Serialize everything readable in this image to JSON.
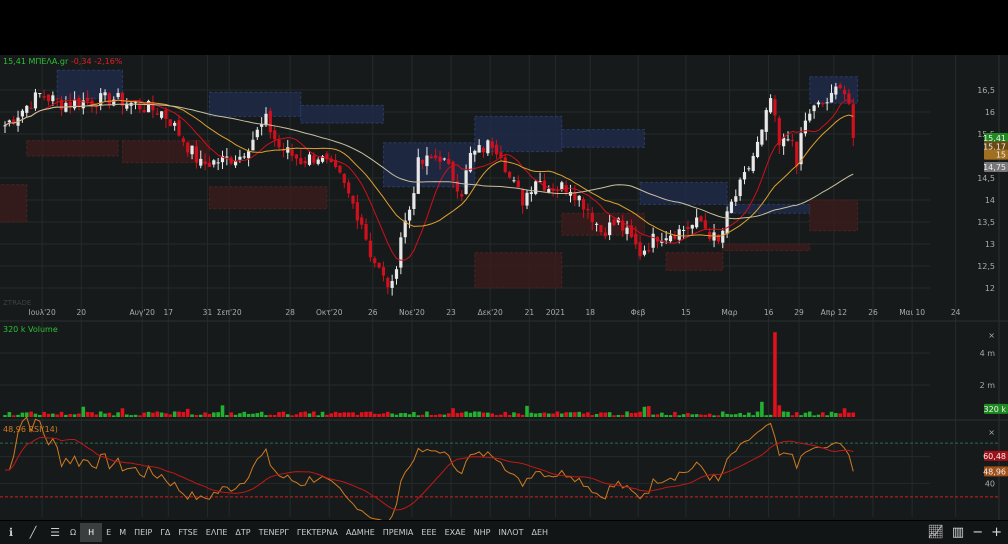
{
  "header": {
    "price": "15,41",
    "symbol": "ΜΠΕΛΑ.gr",
    "change": "-0,34",
    "change_pct": "-2,16%"
  },
  "watermark": "ZTRADE",
  "volume_legend": "320 k Volume",
  "rsi_legend": "48,96 RSI(14)",
  "toolbar": {
    "items": [
      "Ω",
      "Η",
      "Ε",
      "Μ",
      "ΠΕΙΡ",
      "ΓΔ",
      "FTSE",
      "ΕΛΠΕ",
      "ΔΤΡ",
      "ΤΕΝΕΡΓ",
      "ΓΕΚΤΕΡΝΑ",
      "ΑΔΜΗΕ",
      "ΠΡΕΜΙΑ",
      "ΕΕΕ",
      "ΕΧΑΕ",
      "ΝΗΡ",
      "ΙΝΛΟΤ",
      "ΔΕΗ"
    ],
    "active": "Η"
  },
  "colors": {
    "up": "#e8e8e8",
    "down": "#d0101c",
    "ma_short": "#d0101c",
    "ma_mid": "#e0a030",
    "ma_long": "#c8c0a0",
    "vol_up": "#23b030",
    "vol_down": "#e0101c",
    "rsi": "#d07a20",
    "rsi_ma": "#c01818"
  },
  "chart_data": [
    {
      "type": "candlestick",
      "title": "ΜΠΕΛΑ.gr",
      "price_keypoints": [
        [
          0,
          15.7
        ],
        [
          8,
          16.4
        ],
        [
          13,
          16.2
        ],
        [
          25,
          16.3
        ],
        [
          36,
          16.0
        ],
        [
          38,
          15.8
        ],
        [
          45,
          14.8
        ],
        [
          54,
          15.0
        ],
        [
          60,
          15.8
        ],
        [
          63,
          15.2
        ],
        [
          68,
          14.9
        ],
        [
          72,
          15.0
        ],
        [
          77,
          14.5
        ],
        [
          82,
          13.5
        ],
        [
          84,
          12.8
        ],
        [
          87,
          12.2
        ],
        [
          89,
          12.0
        ],
        [
          91,
          13.2
        ],
        [
          93,
          13.8
        ],
        [
          95,
          14.8
        ],
        [
          100,
          15.0
        ],
        [
          105,
          14.2
        ],
        [
          107,
          15.0
        ],
        [
          112,
          15.3
        ],
        [
          114,
          15.1
        ],
        [
          116,
          14.5
        ],
        [
          119,
          14.0
        ],
        [
          122,
          14.5
        ],
        [
          125,
          14.3
        ],
        [
          130,
          14.3
        ],
        [
          134,
          13.8
        ],
        [
          137,
          13.3
        ],
        [
          141,
          13.5
        ],
        [
          146,
          12.8
        ],
        [
          150,
          13.2
        ],
        [
          155,
          13.3
        ],
        [
          160,
          13.5
        ],
        [
          164,
          13.0
        ],
        [
          167,
          13.9
        ],
        [
          170,
          14.5
        ],
        [
          174,
          15.5
        ],
        [
          176,
          16.3
        ],
        [
          178,
          15.2
        ],
        [
          181,
          15.5
        ],
        [
          182,
          14.6
        ],
        [
          183,
          15.5
        ],
        [
          185,
          16.0
        ],
        [
          190,
          16.3
        ],
        [
          192,
          16.7
        ],
        [
          194,
          16.2
        ],
        [
          195,
          15.41
        ]
      ],
      "yaxis": {
        "ticks": [
          "16,5",
          "16",
          "15,5",
          "14,5",
          "14",
          "13,5",
          "13",
          "12,5",
          "12"
        ],
        "tick_values": [
          16.5,
          16,
          15.5,
          14.5,
          14,
          13.5,
          13,
          12.5,
          12
        ],
        "range": [
          11.75,
          17.1
        ]
      },
      "xaxis": {
        "ticks": [
          "Ιουλ'20",
          "20",
          "Αυγ'20",
          "17",
          "31",
          "Σεπ'20",
          "28",
          "Οκτ'20",
          "26",
          "Νοε'20",
          "23",
          "Δεκ'20",
          "21",
          "2021",
          "18",
          "Φεβ",
          "15",
          "Μαρ",
          "16",
          "29",
          "Απρ 12",
          "26",
          "Μαι 10",
          "24"
        ],
        "tick_index": [
          9,
          18,
          32,
          38,
          47,
          52,
          66,
          75,
          85,
          94,
          103,
          112,
          121,
          127,
          135,
          146,
          157,
          167,
          176,
          183,
          191,
          200,
          209,
          219
        ]
      },
      "moving_averages": [
        {
          "name": "MA short",
          "period": 10,
          "last": "15,17"
        },
        {
          "name": "MA mid",
          "period": 20,
          "last": "15"
        },
        {
          "name": "MA long",
          "period": 50,
          "last": "14,75"
        }
      ],
      "last_price": "15,41",
      "zones": [
        {
          "i0": 12,
          "i1": 27,
          "p0": 16.95,
          "p1": 16.3,
          "kind": "supply"
        },
        {
          "i0": 47,
          "i1": 68,
          "p0": 16.45,
          "p1": 15.9,
          "kind": "supply"
        },
        {
          "i0": 68,
          "i1": 87,
          "p0": 16.15,
          "p1": 15.75,
          "kind": "supply"
        },
        {
          "i0": 87,
          "i1": 108,
          "p0": 15.3,
          "p1": 14.3,
          "kind": "supply"
        },
        {
          "i0": 108,
          "i1": 128,
          "p0": 15.9,
          "p1": 15.1,
          "kind": "supply"
        },
        {
          "i0": 128,
          "i1": 147,
          "p0": 15.6,
          "p1": 15.2,
          "kind": "supply"
        },
        {
          "i0": 146,
          "i1": 166,
          "p0": 14.4,
          "p1": 13.9,
          "kind": "supply"
        },
        {
          "i0": 166,
          "i1": 185,
          "p0": 13.9,
          "p1": 13.7,
          "kind": "supply"
        },
        {
          "i0": 185,
          "i1": 196,
          "p0": 16.8,
          "p1": 16.2,
          "kind": "supply"
        },
        {
          "i0": 5,
          "i1": 26,
          "p0": 15.35,
          "p1": 15.0,
          "kind": "demand"
        },
        {
          "i0": 27,
          "i1": 47,
          "p0": 15.35,
          "p1": 14.85,
          "kind": "demand"
        },
        {
          "i0": 47,
          "i1": 74,
          "p0": 14.3,
          "p1": 13.8,
          "kind": "demand"
        },
        {
          "i0": 108,
          "i1": 128,
          "p0": 12.8,
          "p1": 12.0,
          "kind": "demand"
        },
        {
          "i0": 128,
          "i1": 147,
          "p0": 13.7,
          "p1": 13.2,
          "kind": "demand"
        },
        {
          "i0": 152,
          "i1": 165,
          "p0": 12.8,
          "p1": 12.4,
          "kind": "demand"
        },
        {
          "i0": 165,
          "i1": 185,
          "p0": 13.0,
          "p1": 12.85,
          "kind": "demand"
        },
        {
          "i0": 185,
          "i1": 196,
          "p0": 14.0,
          "p1": 13.3,
          "kind": "demand"
        },
        {
          "i0": -2,
          "i1": 5,
          "p0": 14.35,
          "p1": 13.5,
          "kind": "demand"
        }
      ]
    },
    {
      "type": "bar",
      "title": "Volume",
      "yaxis": {
        "ticks": [
          "4 m",
          "2 m"
        ],
        "tick_values": [
          4,
          2
        ],
        "unit": "m"
      },
      "last": "320 k",
      "spike_index": 177,
      "spike_value": 5.3
    },
    {
      "type": "line",
      "title": "RSI(14)",
      "yaxis": {
        "ticks": [
          "60",
          "40"
        ],
        "tick_values": [
          60,
          40
        ],
        "range": [
          15,
          85
        ]
      },
      "levels": [
        70,
        30
      ],
      "last_rsi": "48,96",
      "last_ma": "60,48"
    }
  ]
}
